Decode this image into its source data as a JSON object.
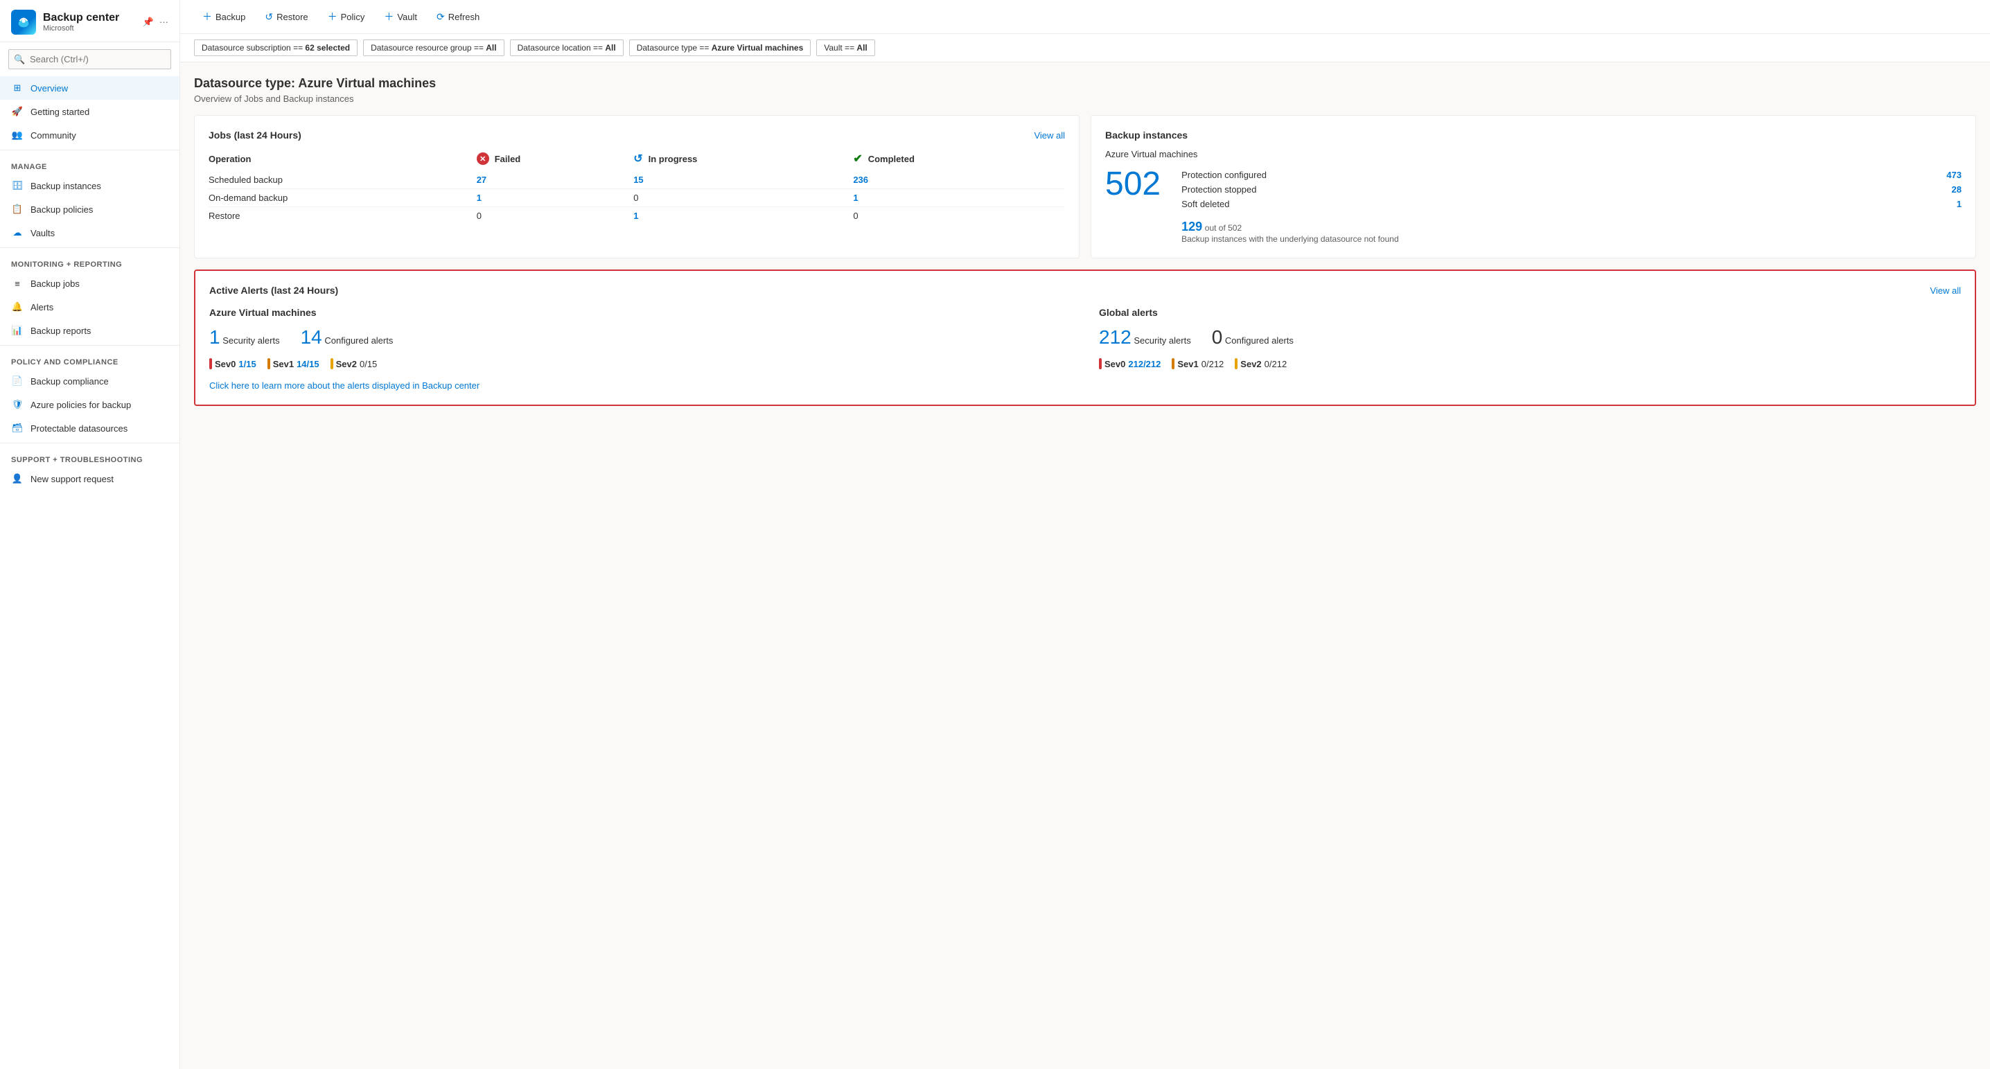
{
  "sidebar": {
    "app_title": "Backup center",
    "app_subtitle": "Microsoft",
    "search_placeholder": "Search (Ctrl+/)",
    "nav_items": [
      {
        "id": "overview",
        "label": "Overview",
        "active": true,
        "icon": "overview"
      },
      {
        "id": "getting-started",
        "label": "Getting started",
        "active": false,
        "icon": "getting-started"
      },
      {
        "id": "community",
        "label": "Community",
        "active": false,
        "icon": "community"
      }
    ],
    "manage_label": "Manage",
    "manage_items": [
      {
        "id": "backup-instances",
        "label": "Backup instances",
        "icon": "backup-instances"
      },
      {
        "id": "backup-policies",
        "label": "Backup policies",
        "icon": "backup-policies"
      },
      {
        "id": "vaults",
        "label": "Vaults",
        "icon": "vaults"
      }
    ],
    "monitoring_label": "Monitoring + reporting",
    "monitoring_items": [
      {
        "id": "backup-jobs",
        "label": "Backup jobs",
        "icon": "backup-jobs"
      },
      {
        "id": "alerts",
        "label": "Alerts",
        "icon": "alerts"
      },
      {
        "id": "backup-reports",
        "label": "Backup reports",
        "icon": "backup-reports"
      }
    ],
    "policy_label": "Policy and compliance",
    "policy_items": [
      {
        "id": "backup-compliance",
        "label": "Backup compliance",
        "icon": "backup-compliance"
      },
      {
        "id": "azure-policies",
        "label": "Azure policies for backup",
        "icon": "azure-policies"
      },
      {
        "id": "protectable-datasources",
        "label": "Protectable datasources",
        "icon": "protectable-datasources"
      }
    ],
    "support_label": "Support + troubleshooting",
    "support_items": [
      {
        "id": "new-support-request",
        "label": "New support request",
        "icon": "support"
      }
    ]
  },
  "toolbar": {
    "backup_label": "Backup",
    "restore_label": "Restore",
    "policy_label": "Policy",
    "vault_label": "Vault",
    "refresh_label": "Refresh"
  },
  "filters": [
    {
      "label": "Datasource subscription == ",
      "value": "62 selected"
    },
    {
      "label": "Datasource resource group == ",
      "value": "All"
    },
    {
      "label": "Datasource location == ",
      "value": "All"
    },
    {
      "label": "Datasource type == ",
      "value": "Azure Virtual machines"
    },
    {
      "label": "Vault == ",
      "value": "All"
    }
  ],
  "datasource": {
    "type_label": "Datasource type: Azure Virtual machines",
    "subtitle": "Overview of Jobs and Backup instances"
  },
  "jobs_card": {
    "title": "Jobs (last 24 Hours)",
    "view_all_label": "View all",
    "col_operation": "Operation",
    "col_failed": "Failed",
    "col_inprogress": "In progress",
    "col_completed": "Completed",
    "rows": [
      {
        "operation": "Scheduled backup",
        "failed": "27",
        "inprogress": "15",
        "completed": "236"
      },
      {
        "operation": "On-demand backup",
        "failed": "1",
        "inprogress": "0",
        "completed": "1"
      },
      {
        "operation": "Restore",
        "failed": "0",
        "inprogress": "1",
        "completed": "0"
      }
    ]
  },
  "backup_instances_card": {
    "title": "Backup instances",
    "subtitle": "Azure Virtual machines",
    "total": "502",
    "protection_configured_label": "Protection configured",
    "protection_configured_val": "473",
    "protection_stopped_label": "Protection stopped",
    "protection_stopped_val": "28",
    "soft_deleted_label": "Soft deleted",
    "soft_deleted_val": "1",
    "secondary_num": "129",
    "secondary_suffix": "out of 502",
    "secondary_desc": "Backup instances with the underlying datasource not found"
  },
  "alerts_card": {
    "title": "Active Alerts (last 24 Hours)",
    "view_all_label": "View all",
    "azure_col_title": "Azure Virtual machines",
    "azure_security_count": "1",
    "azure_security_label": "Security alerts",
    "azure_configured_count": "14",
    "azure_configured_label": "Configured alerts",
    "azure_sevs": [
      {
        "level": "Sev0",
        "val": "1/15",
        "color": "red"
      },
      {
        "level": "Sev1",
        "val": "14/15",
        "color": "orange"
      },
      {
        "level": "Sev2",
        "val": "0/15",
        "color": "yellow"
      }
    ],
    "global_col_title": "Global alerts",
    "global_security_count": "212",
    "global_security_label": "Security alerts",
    "global_configured_count": "0",
    "global_configured_label": "Configured alerts",
    "global_sevs": [
      {
        "level": "Sev0",
        "val": "212/212",
        "color": "red"
      },
      {
        "level": "Sev1",
        "val": "0/212",
        "color": "orange"
      },
      {
        "level": "Sev2",
        "val": "0/212",
        "color": "yellow"
      }
    ],
    "learn_more_link": "Click here to learn more about the alerts displayed in Backup center"
  }
}
